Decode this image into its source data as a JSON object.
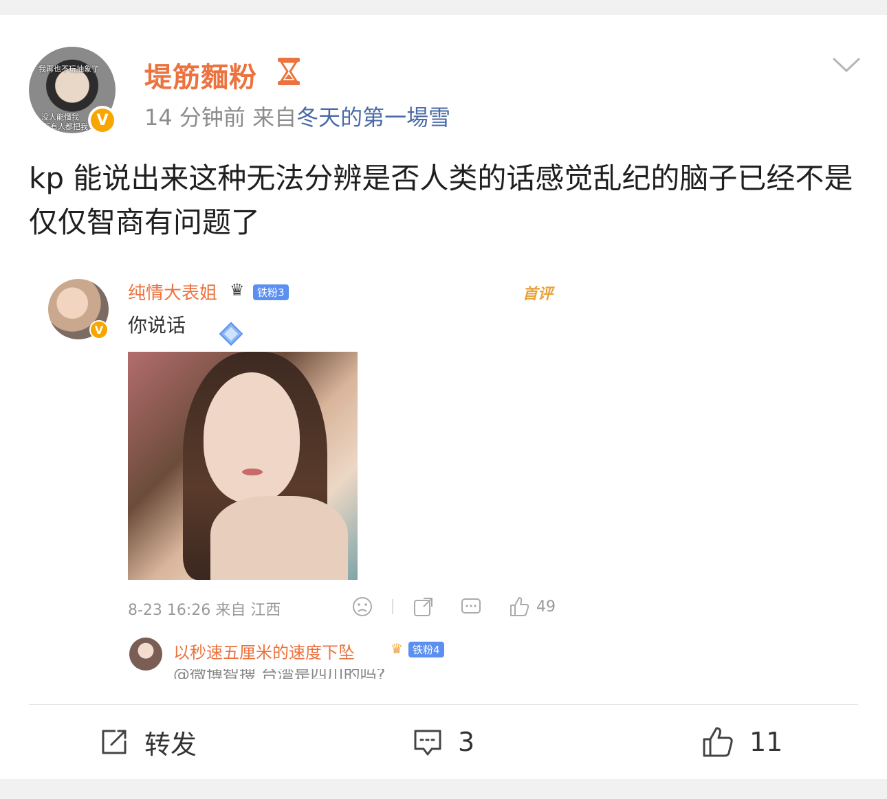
{
  "post": {
    "avatar_caption_top": "我再也不玩抽象了",
    "avatar_caption_bottom1": "没人能懂我",
    "avatar_caption_bottom2": "所有人都把我",
    "verified_badge": "V",
    "username": "堤筋麵粉",
    "hourglass_icon": "hourglass-icon",
    "time": "14 分钟前",
    "source_prefix": "来自",
    "source": "冬天的第一場雪",
    "text": "kp 能说出来这种无法分辨是否人类的话感觉乱纪的脑子已经不是仅仅智商有问题了"
  },
  "embedded_screenshot": {
    "comment": {
      "name": "纯情大表姐",
      "fan_badge": "铁粉3",
      "tag": "首评",
      "text": "你说话",
      "verified_badge": "V",
      "date": "8-23 16:26",
      "from_label": "来自",
      "location": "江西",
      "like_count": "49"
    },
    "reply": {
      "name": "以秒速五厘米的速度下坠",
      "fan_badge": "铁粉4",
      "text_cut": "@微博智搜 台湾是四川的吗?"
    }
  },
  "actions": {
    "repost_label": "转发",
    "comment_count": "3",
    "like_count": "11"
  },
  "colors": {
    "username": "#eb7340",
    "source_link": "#4a6aa6",
    "verified": "#f7a600",
    "meta_text": "#8c8c8c"
  }
}
